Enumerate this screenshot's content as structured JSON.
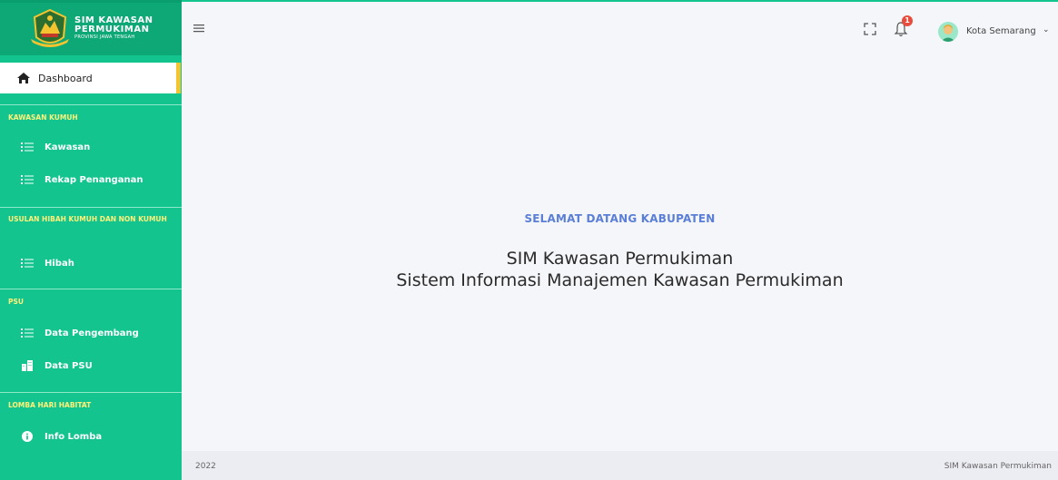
{
  "brand": {
    "title_line1": "SIM KAWASAN",
    "title_line2": "PERMUKIMAN",
    "subtitle": "PROVINSI JAWA TENGAH"
  },
  "sidebar": {
    "dashboard": {
      "label": "Dashboard",
      "icon": "home-icon",
      "active": true
    },
    "sections": [
      {
        "title": "KAWASAN KUMUH",
        "items": [
          {
            "label": "Kawasan",
            "icon": "list-icon"
          },
          {
            "label": "Rekap Penanganan",
            "icon": "list-icon"
          }
        ]
      },
      {
        "title": "USULAN HIBAH KUMUH DAN NON KUMUH",
        "items": [
          {
            "label": "Hibah",
            "icon": "list-icon"
          }
        ]
      },
      {
        "title": "PSU",
        "items": [
          {
            "label": "Data Pengembang",
            "icon": "list-icon"
          },
          {
            "label": "Data PSU",
            "icon": "building-icon"
          }
        ]
      },
      {
        "title": "LOMBA HARI HABITAT",
        "items": [
          {
            "label": "Info Lomba",
            "icon": "info-icon"
          }
        ]
      }
    ]
  },
  "header": {
    "notification_count": "1",
    "user_name": "Kota Semarang",
    "caret": "⌄"
  },
  "main": {
    "welcome": "SELAMAT DATANG KABUPATEN",
    "title": "SIM Kawasan Permukiman",
    "subtitle": "Sistem Informasi Manajemen Kawasan Permukiman"
  },
  "footer": {
    "year": "2022",
    "app_name": "SIM Kawasan Permukiman"
  },
  "colors": {
    "sidebar": "#13c48e",
    "section_title": "#fff37a",
    "active_accent": "#f4c430",
    "welcome_text": "#5b7fd6",
    "badge": "#e74c3c"
  }
}
